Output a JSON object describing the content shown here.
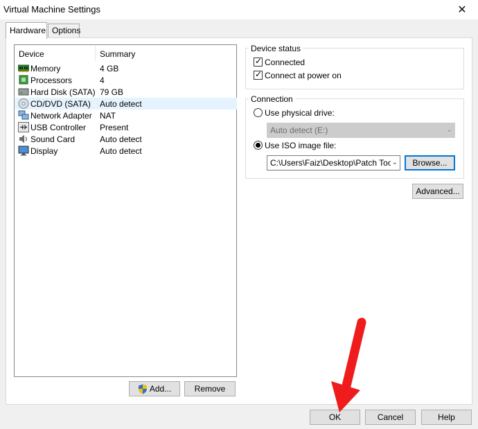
{
  "window": {
    "title": "Virtual Machine Settings",
    "close_glyph": "✕"
  },
  "tabs": [
    {
      "label": "Hardware",
      "active": true
    },
    {
      "label": "Options",
      "active": false
    }
  ],
  "device_list": {
    "headers": {
      "device": "Device",
      "summary": "Summary"
    },
    "items": [
      {
        "name": "Memory",
        "summary": "4 GB",
        "icon": "memory-icon"
      },
      {
        "name": "Processors",
        "summary": "4",
        "icon": "processor-icon"
      },
      {
        "name": "Hard Disk (SATA)",
        "summary": "79 GB",
        "icon": "hard-disk-icon"
      },
      {
        "name": "CD/DVD (SATA)",
        "summary": "Auto detect",
        "icon": "cd-dvd-icon",
        "selected": true
      },
      {
        "name": "Network Adapter",
        "summary": "NAT",
        "icon": "network-adapter-icon"
      },
      {
        "name": "USB Controller",
        "summary": "Present",
        "icon": "usb-icon"
      },
      {
        "name": "Sound Card",
        "summary": "Auto detect",
        "icon": "sound-card-icon"
      },
      {
        "name": "Display",
        "summary": "Auto detect",
        "icon": "display-icon"
      }
    ]
  },
  "list_buttons": {
    "add": "Add...",
    "remove": "Remove"
  },
  "device_status": {
    "title": "Device status",
    "connected": {
      "label": "Connected",
      "checked": true
    },
    "connect_at_power_on": {
      "label": "Connect at power on",
      "checked": true
    }
  },
  "connection": {
    "title": "Connection",
    "physical_drive": {
      "label": "Use physical drive:",
      "selected": false,
      "value": "Auto detect (E:)"
    },
    "iso_image": {
      "label": "Use ISO image file:",
      "selected": true,
      "value": "C:\\Users\\Faiz\\Desktop\\Patch Tool\\"
    },
    "browse": "Browse..."
  },
  "advanced_button": "Advanced...",
  "footer_buttons": {
    "ok": "OK",
    "cancel": "Cancel",
    "help": "Help"
  },
  "colors": {
    "annotation_arrow": "#ee1c1c",
    "selection": "#e5f3ff",
    "focus": "#0078d7"
  }
}
